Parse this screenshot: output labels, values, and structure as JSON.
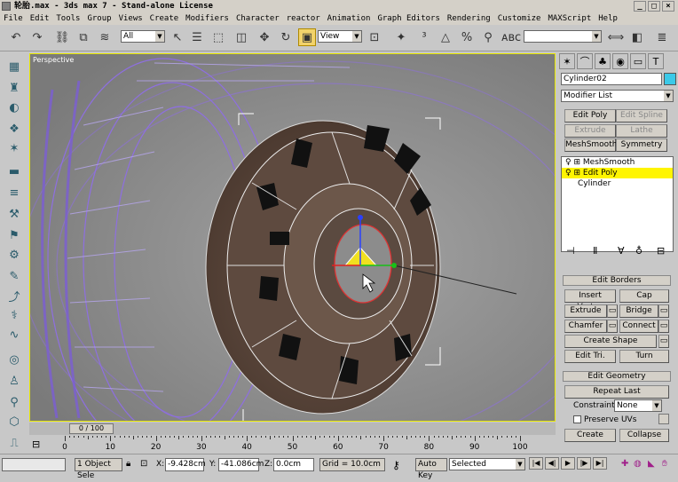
{
  "window": {
    "title": "轮胎.max - 3ds max 7 - Stand-alone License",
    "controls": [
      "_",
      "□",
      "×"
    ]
  },
  "menu": [
    "File",
    "Edit",
    "Tools",
    "Group",
    "Views",
    "Create",
    "Modifiers",
    "Character",
    "reactor",
    "Animation",
    "Graph Editors",
    "Rendering",
    "Customize",
    "MAXScript",
    "Help"
  ],
  "toolbar": {
    "selection_filter": "All",
    "ref_coord": "View",
    "named_sel": ""
  },
  "viewport": {
    "label": "Perspective"
  },
  "command_panel": {
    "object_name": "Cylinder02",
    "object_color": "#3bc9e8",
    "modifier_list": "Modifier List",
    "mod_buttons": [
      "Edit Poly",
      "Edit Spline",
      "Extrude",
      "Lathe",
      "MeshSmooth",
      "Symmetry"
    ],
    "stack": [
      "MeshSmooth",
      "Edit Poly",
      "Cylinder"
    ],
    "edit_borders": {
      "header": "Edit Borders",
      "insert_vertex": "Insert Vertex",
      "cap": "Cap",
      "extrude": "Extrude",
      "bridge": "Bridge",
      "chamfer": "Chamfer",
      "connect": "Connect",
      "create_shape": "Create Shape",
      "edit_tri": "Edit Tri.",
      "turn": "Turn"
    },
    "edit_geometry": {
      "header": "Edit Geometry",
      "repeat_last": "Repeat Last",
      "constraints_label": "Constraints:",
      "constraints_value": "None",
      "preserve_uvs": "Preserve UVs",
      "create": "Create",
      "collapse": "Collapse"
    }
  },
  "timeline": {
    "slider": "0 / 100",
    "ticks": [
      "0",
      "10",
      "20",
      "30",
      "40",
      "50",
      "60",
      "70",
      "80",
      "90",
      "100"
    ]
  },
  "status": {
    "selection": "1 Object Sele",
    "x_label": "X:",
    "x_value": "-9.428cm",
    "y_label": "Y:",
    "y_value": "-41.086cm",
    "z_label": "Z:",
    "z_value": "0.0cm",
    "grid": "Grid = 10.0cm",
    "auto_key": "Auto Key",
    "key_mode": "Selected"
  }
}
